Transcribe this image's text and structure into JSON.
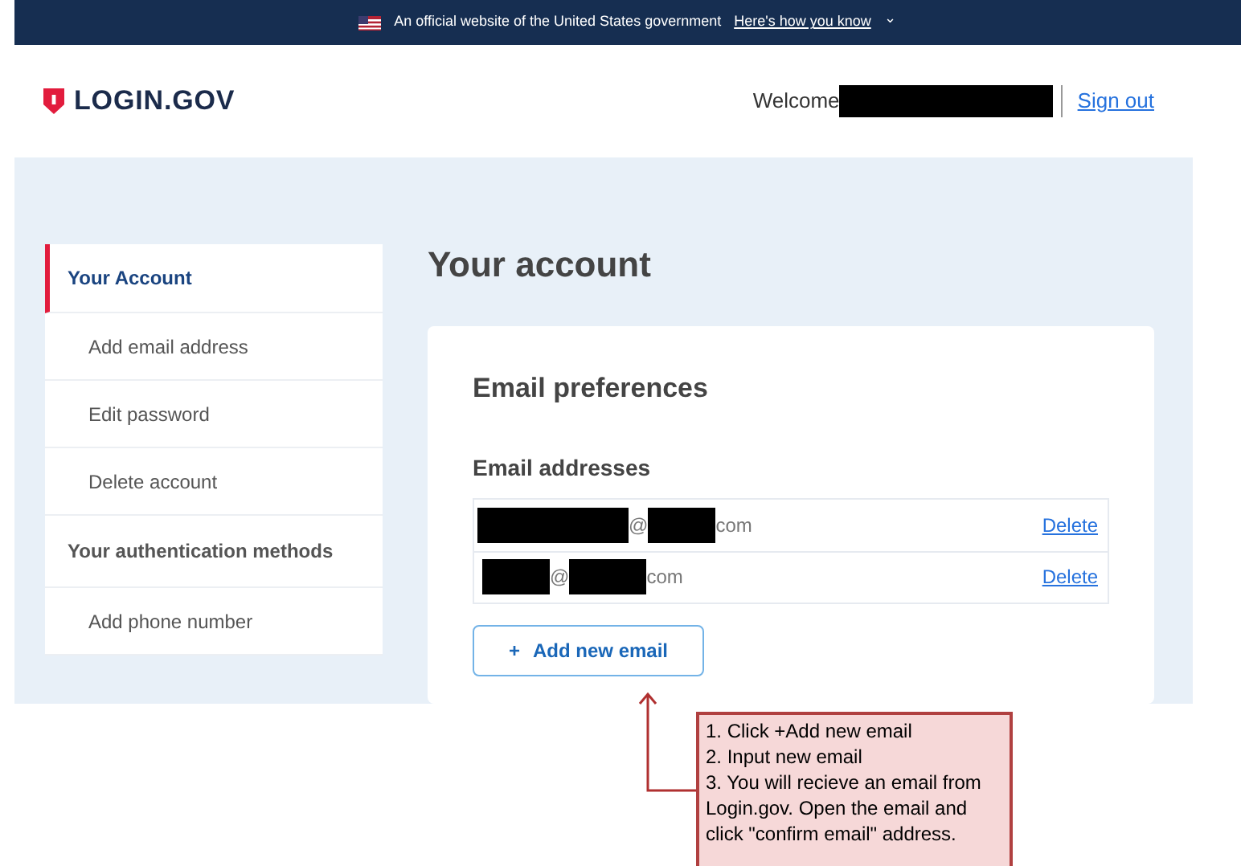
{
  "banner": {
    "text": "An official website of the United States government",
    "link": "Here's how you know",
    "caret": "⌄"
  },
  "header": {
    "logo": "LOGIN.GOV",
    "welcome": "Welcome",
    "sign_out": "Sign out"
  },
  "sidebar": {
    "items": [
      {
        "label": "Your Account",
        "kind": "section",
        "selected": true
      },
      {
        "label": "Add email address",
        "kind": "link",
        "selected": false
      },
      {
        "label": "Edit password",
        "kind": "link",
        "selected": false
      },
      {
        "label": "Delete account",
        "kind": "link",
        "selected": false
      },
      {
        "label": "Your authentication methods",
        "kind": "section",
        "selected": false
      },
      {
        "label": "Add phone number",
        "kind": "link",
        "selected": false
      }
    ]
  },
  "main": {
    "title": "Your account",
    "card": {
      "title": "Email preferences",
      "subtitle": "Email addresses",
      "emails": [
        {
          "at": "@",
          "suffix": "com",
          "action": "Delete"
        },
        {
          "at": "@",
          "suffix": "com",
          "action": "Delete"
        }
      ],
      "add_button": {
        "icon": "+",
        "label": "Add new email"
      }
    }
  },
  "annotation": {
    "lines": [
      "1. Click +Add new email",
      "2. Input new email",
      "3. You will recieve an email from Login.gov. Open the email and click \"confirm email\" address."
    ]
  }
}
